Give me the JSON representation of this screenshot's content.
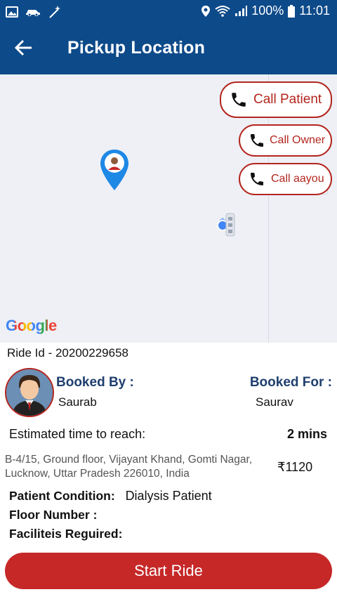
{
  "status_bar": {
    "battery": "100%",
    "time": "11:01",
    "left_icons": [
      "gallery-icon",
      "car-icon",
      "wand-icon"
    ],
    "right_icons": [
      "location-icon",
      "wifi-icon",
      "signal-icon",
      "battery-icon"
    ]
  },
  "app_bar": {
    "title": "Pickup Location",
    "back_icon": "arrow-left-icon"
  },
  "map": {
    "logo": "Google",
    "buttons": {
      "call_patient": "Call Patient",
      "call_owner": "Call Owner",
      "call_aayou": "Call aayou"
    },
    "colors": {
      "call_accent": "#b3261e",
      "map_bg": "#eef0f6"
    }
  },
  "ride": {
    "id_text": "Ride Id - 20200229658",
    "booked_by_label": "Booked By :",
    "booked_by_value": "Saurab",
    "booked_for_label": "Booked For :",
    "booked_for_value": "Saurav",
    "eta_label": "Estimated time to reach:",
    "eta_value": "2 mins",
    "address": "B-4/15, Ground floor, Vijayant Khand, Gomti Nagar, Lucknow, Uttar Pradesh 226010, India",
    "fare": "₹1120",
    "condition_label": "Patient Condition:",
    "condition_value": "Dialysis Patient",
    "floor_label": "Floor Number :",
    "facilities_label": "Faciliteis Reguired:"
  },
  "actions": {
    "start_ride": "Start Ride"
  },
  "theme": {
    "primary": "#0d4a8a",
    "accent_red": "#c62828",
    "label_blue": "#1f3f6e"
  }
}
